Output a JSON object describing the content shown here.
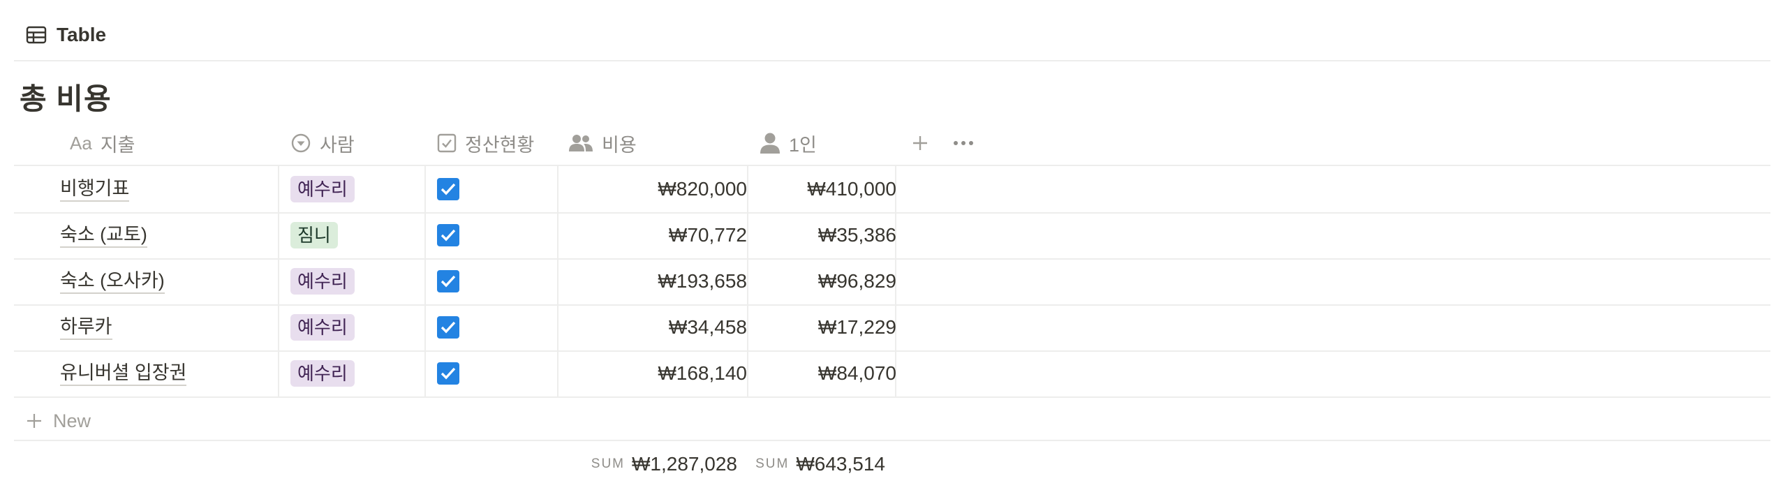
{
  "view": {
    "tab_label": "Table",
    "icon": "table-icon"
  },
  "title": "총 비용",
  "columns": [
    {
      "label": "지출",
      "icon": "text-property-icon"
    },
    {
      "label": "사람",
      "icon": "select-property-icon"
    },
    {
      "label": "정산현황",
      "icon": "checkbox-property-icon"
    },
    {
      "label": "비용",
      "icon": "people-icon"
    },
    {
      "label": "1인",
      "icon": "person-icon"
    }
  ],
  "rows": [
    {
      "name": "비행기표",
      "person": "예수리",
      "person_color": "purple",
      "settled": true,
      "cost": "₩820,000",
      "per_person": "₩410,000"
    },
    {
      "name": "숙소 (교토)",
      "person": "짐니",
      "person_color": "green",
      "settled": true,
      "cost": "₩70,772",
      "per_person": "₩35,386"
    },
    {
      "name": "숙소 (오사카)",
      "person": "예수리",
      "person_color": "purple",
      "settled": true,
      "cost": "₩193,658",
      "per_person": "₩96,829"
    },
    {
      "name": "하루카",
      "person": "예수리",
      "person_color": "purple",
      "settled": true,
      "cost": "₩34,458",
      "per_person": "₩17,229"
    },
    {
      "name": "유니버셜 입장권",
      "person": "예수리",
      "person_color": "purple",
      "settled": true,
      "cost": "₩168,140",
      "per_person": "₩84,070"
    }
  ],
  "new_row_label": "New",
  "footer": {
    "cost_sum_label": "SUM",
    "cost_sum": "₩1,287,028",
    "per_person_sum_label": "SUM",
    "per_person_sum": "₩643,514"
  },
  "colors": {
    "checkbox": "#2383e2",
    "tag_purple_bg": "#e8deee",
    "tag_green_bg": "#dbeddb"
  }
}
